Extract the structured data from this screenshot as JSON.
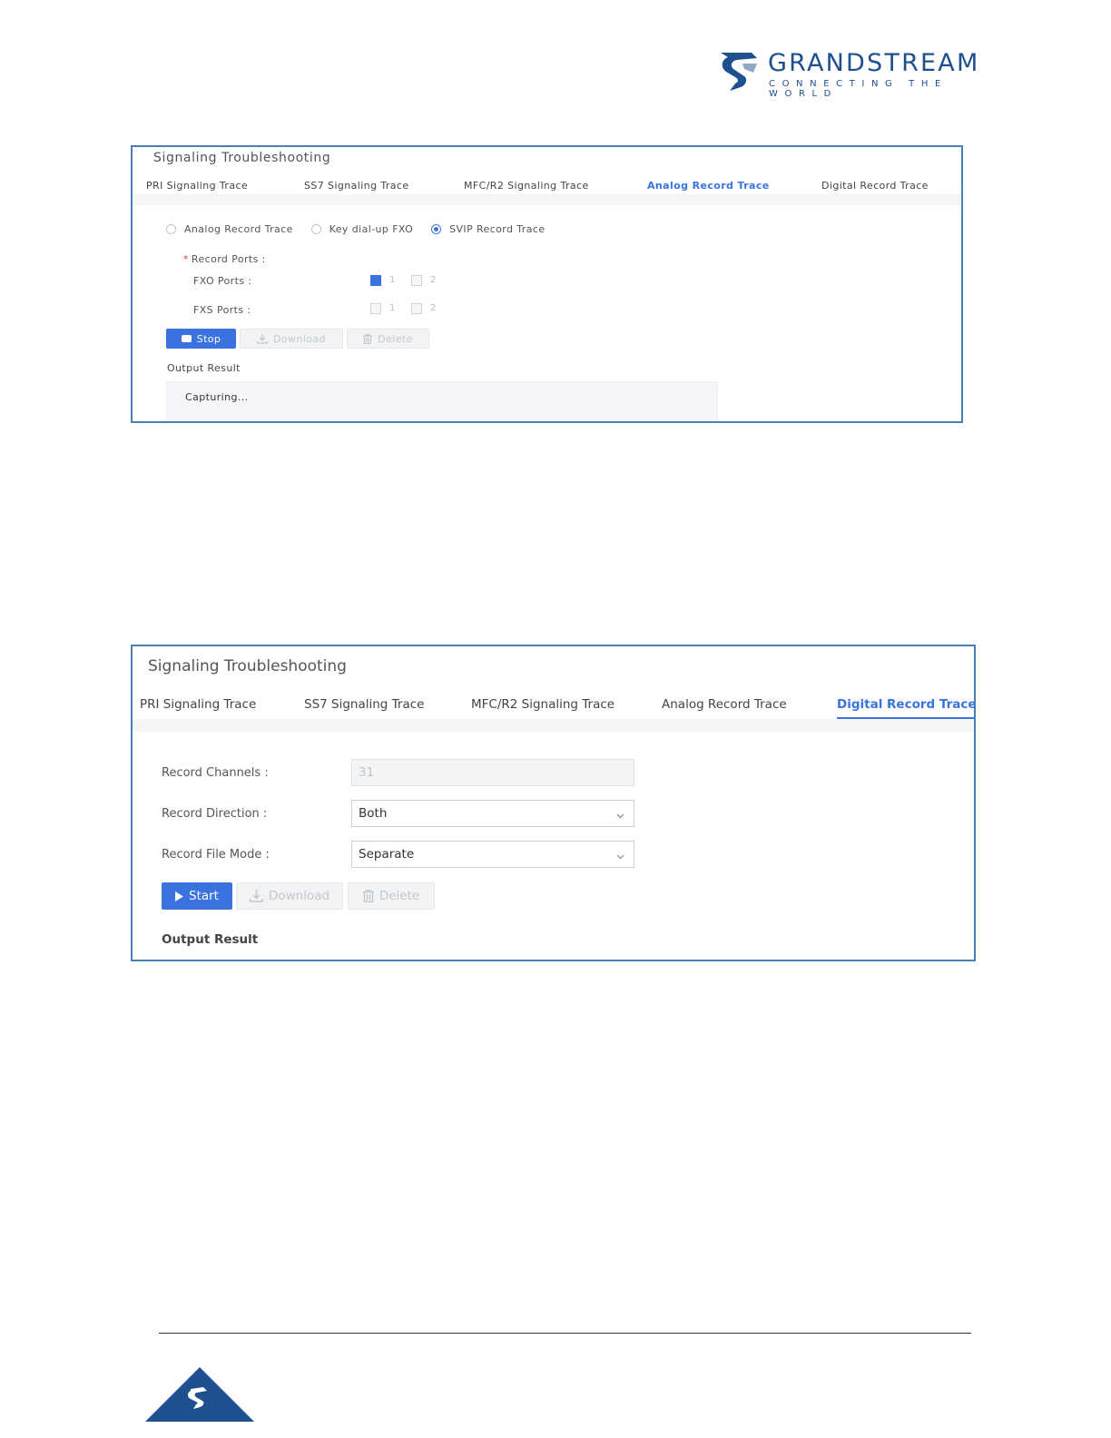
{
  "header": {
    "brand_name": "GRANDSTREAM",
    "tagline": "CONNECTING THE WORLD"
  },
  "colors": {
    "accent": "#3a73e0",
    "brand": "#1e4f8e",
    "panel_border": "#4a7fb5"
  },
  "panel1": {
    "title": "Signaling Troubleshooting",
    "tabs": [
      {
        "label": "PRI Signaling Trace",
        "active": false
      },
      {
        "label": "SS7 Signaling Trace",
        "active": false
      },
      {
        "label": "MFC/R2 Signaling Trace",
        "active": false
      },
      {
        "label": "Analog Record Trace",
        "active": true
      },
      {
        "label": "Digital Record Trace",
        "active": false
      }
    ],
    "radios": [
      {
        "label": "Analog Record Trace",
        "checked": false
      },
      {
        "label": "Key dial-up FXO",
        "checked": false
      },
      {
        "label": "SVIP Record Trace",
        "checked": true
      }
    ],
    "record_ports_label": "Record Ports :",
    "fxo_label": "FXO Ports :",
    "fxs_label": "FXS Ports :",
    "fxo_ports": [
      {
        "num": "1",
        "checked": true
      },
      {
        "num": "2",
        "checked": false
      }
    ],
    "fxs_ports": [
      {
        "num": "1",
        "checked": false
      },
      {
        "num": "2",
        "checked": false
      }
    ],
    "buttons": {
      "stop": "Stop",
      "download": "Download",
      "delete": "Delete"
    },
    "output_label": "Output Result",
    "output_text": "Capturing..."
  },
  "panel2": {
    "title": "Signaling Troubleshooting",
    "tabs": [
      {
        "label": "PRI Signaling Trace",
        "active": false
      },
      {
        "label": "SS7 Signaling Trace",
        "active": false
      },
      {
        "label": "MFC/R2 Signaling Trace",
        "active": false
      },
      {
        "label": "Analog Record Trace",
        "active": false
      },
      {
        "label": "Digital Record Trace",
        "active": true
      }
    ],
    "record_channels_label": "Record Channels :",
    "record_channels_value": "31",
    "record_direction_label": "Record Direction :",
    "record_direction_value": "Both",
    "record_file_mode_label": "Record File Mode :",
    "record_file_mode_value": "Separate",
    "buttons": {
      "start": "Start",
      "download": "Download",
      "delete": "Delete"
    },
    "output_label": "Output Result"
  }
}
